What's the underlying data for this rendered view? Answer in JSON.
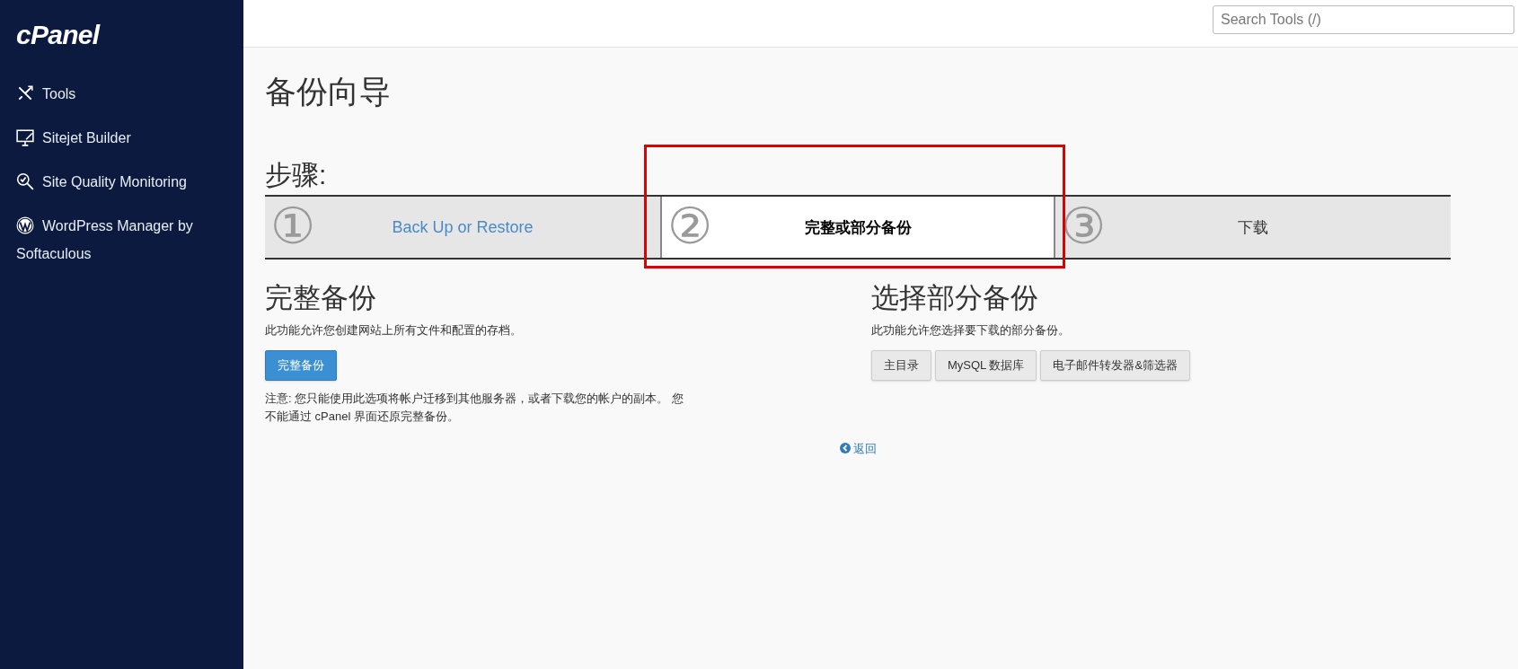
{
  "sidebar": {
    "logo": "cPanel",
    "items": [
      {
        "label": "Tools"
      },
      {
        "label": "Sitejet Builder"
      },
      {
        "label": "Site Quality Monitoring"
      },
      {
        "label": "WordPress Manager by Softaculous"
      }
    ]
  },
  "search": {
    "placeholder": "Search Tools (/)"
  },
  "page_title": "备份向导",
  "steps": {
    "heading": "步骤:",
    "items": [
      {
        "number": "①",
        "label": "Back Up or Restore",
        "kind": "link",
        "selected": false
      },
      {
        "number": "②",
        "label": "完整或部分备份",
        "kind": "current",
        "selected": true
      },
      {
        "number": "③",
        "label": "下载",
        "kind": "pending",
        "selected": false
      }
    ]
  },
  "full_backup": {
    "heading": "完整备份",
    "description": "此功能允许您创建网站上所有文件和配置的存档。",
    "button": "完整备份",
    "note": "注意: 您只能使用此选项将帐户迁移到其他服务器，或者下载您的帐户的副本。 您不能通过 cPanel 界面还原完整备份。"
  },
  "partial_backup": {
    "heading": "选择部分备份",
    "description": "此功能允许您选择要下载的部分备份。",
    "buttons": [
      "主目录",
      "MySQL 数据库",
      "电子邮件转发器&筛选器"
    ]
  },
  "back_link": "返回",
  "highlight": {
    "shown": true
  }
}
